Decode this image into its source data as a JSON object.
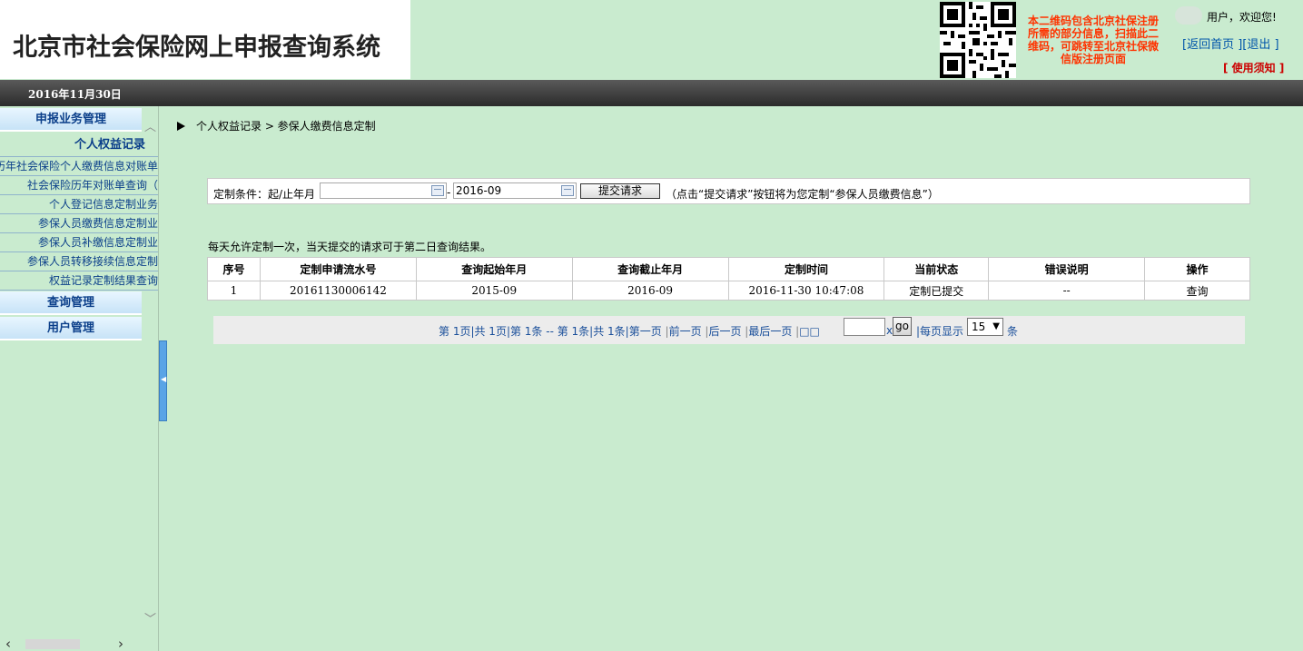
{
  "header": {
    "system_title": "北京市社会保险网上申报查询系统",
    "qr_note": "本二维码包含北京社保注册所需的部分信息，扫描此二维码，可跳转至北京社保微信版注册页面",
    "user_welcome": "用户，欢迎您!",
    "link_home": "[返回首页 ]",
    "link_logout": "[退出 ]",
    "usage_notice": "[ 使用须知 ]"
  },
  "datebar": {
    "date": "2016年11月30日"
  },
  "sidebar": {
    "section_declare": "申报业务管理",
    "section_personal": "个人权益记录",
    "items": [
      "历年社会保险个人缴费信息对账单",
      "社会保险历年对账单查询（",
      "个人登记信息定制业务",
      "参保人员缴费信息定制业",
      "参保人员补缴信息定制业",
      "参保人员转移接续信息定制",
      "权益记录定制结果查询"
    ],
    "section_query": "查询管理",
    "section_user": "用户管理"
  },
  "breadcrumb": "个人权益记录 > 参保人缴费信息定制",
  "filter": {
    "label": "定制条件：起/止年月",
    "start_value": "",
    "end_value": "2016-09",
    "separator": "-",
    "submit_label": "提交请求",
    "hint": "（点击“提交请求”按钮将为您定制“参保人员缴费信息”）"
  },
  "daily_note": "每天允许定制一次，当天提交的请求可于第二日查询结果。",
  "table": {
    "headers": [
      "序号",
      "定制申请流水号",
      "查询起始年月",
      "查询截止年月",
      "定制时间",
      "当前状态",
      "错误说明",
      "操作"
    ],
    "rows": [
      [
        "1",
        "20161130006142",
        "2015-09",
        "2016-09",
        "2016-11-30 10:47:08",
        "定制已提交",
        "--",
        "查询"
      ]
    ]
  },
  "pager": {
    "summary": "第 1页|共 1页|第 1条 -- 第 1条|共 1条|",
    "first": "第一页",
    "prev": "前一页",
    "next": "后一页",
    "last": "最后一页",
    "goto_label": "□□",
    "page_suffix": "x",
    "go_label": "go",
    "per_page_label": "|每页显示",
    "per_page_value": "15",
    "per_page_unit": "条"
  }
}
